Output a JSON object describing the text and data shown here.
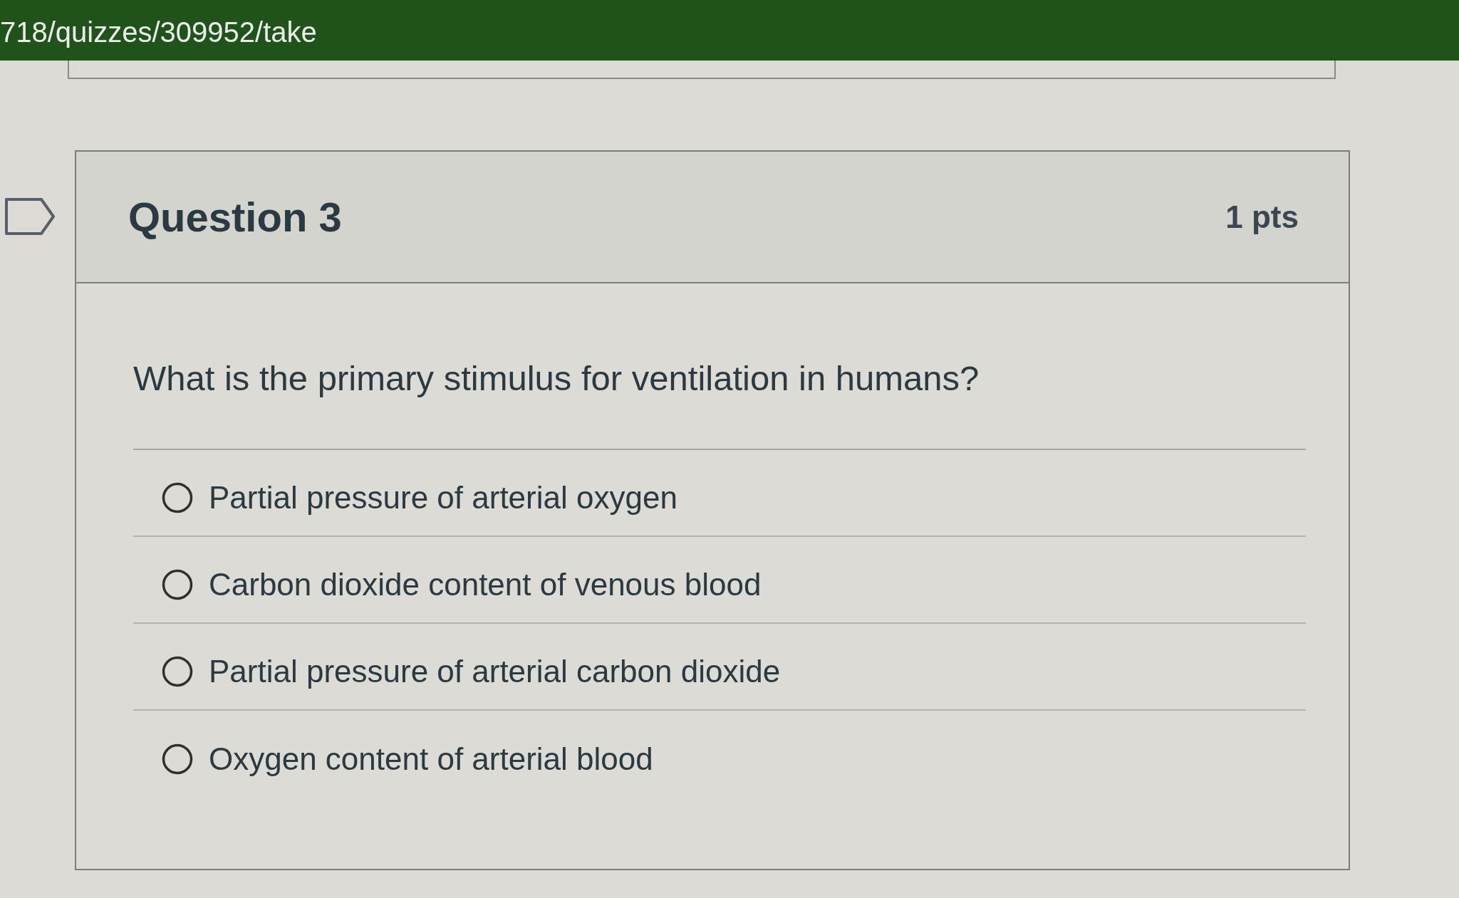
{
  "browser": {
    "url": "718/quizzes/309952/take"
  },
  "question": {
    "title": "Question 3",
    "points": "1 pts",
    "flagged": false,
    "text": "What is the primary stimulus for ventilation in humans?",
    "answers": [
      {
        "label": "Partial pressure of arterial oxygen",
        "selected": false
      },
      {
        "label": "Carbon dioxide content of venous blood",
        "selected": false
      },
      {
        "label": "Partial pressure of arterial carbon dioxide",
        "selected": false
      },
      {
        "label": "Oxygen content of arterial blood",
        "selected": false
      }
    ]
  }
}
